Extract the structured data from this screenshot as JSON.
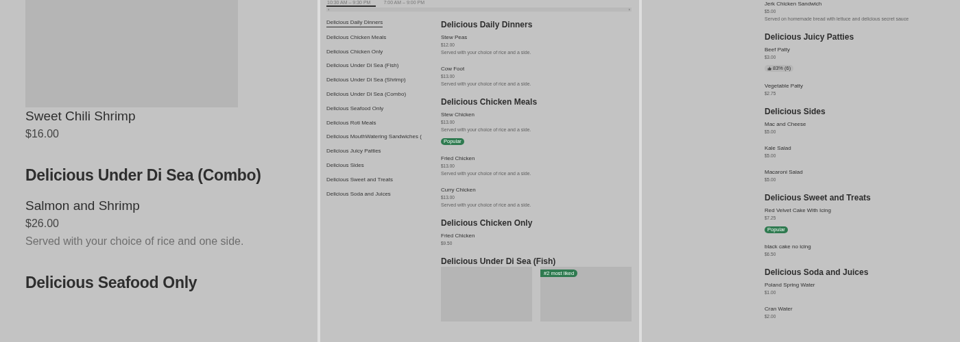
{
  "left_panel": {
    "sections": [
      {
        "items": [
          {
            "image": {
              "kind": "picture"
            },
            "name": "Sweet Chili Shrimp",
            "price": "$16.00"
          }
        ]
      },
      {
        "title": "Delicious Under Di Sea (Combo)",
        "items": [
          {
            "name": "Salmon and Shrimp",
            "price": "$26.00",
            "description": "Served with your choice of rice and one side."
          }
        ]
      },
      {
        "title": "Delicious Seafood Only"
      }
    ]
  },
  "middle_panel": {
    "hours_tabs": [
      {
        "label": "10:30 AM – 9:30 PM",
        "selected": true
      },
      {
        "label": "7:00 AM – 9:00 PM",
        "selected": false
      }
    ],
    "category_nav": [
      {
        "label": "Delicious Daily Dinners",
        "selected": true
      },
      {
        "label": "Delicious Chicken Meals",
        "selected": false
      },
      {
        "label": "Delicious Chicken Only",
        "selected": false
      },
      {
        "label": "Delicious Under Di Sea (Fish)",
        "selected": false
      },
      {
        "label": "Delicious Under Di Sea (Shrimp)",
        "selected": false
      },
      {
        "label": "Delicious Under Di Sea (Combo)",
        "selected": false
      },
      {
        "label": "Delicious Seafood Only",
        "selected": false
      },
      {
        "label": "Delicious Roti Meals",
        "selected": false
      },
      {
        "label": "Delicious MouthWatering Sandwiches (",
        "selected": false
      },
      {
        "label": "Delicious Juicy Patties",
        "selected": false
      },
      {
        "label": "Delicious Sides",
        "selected": false
      },
      {
        "label": "Delicious Sweet and Treats",
        "selected": false
      },
      {
        "label": "Delicious Soda and Juices",
        "selected": false
      }
    ],
    "sections": [
      {
        "title": "Delicious Daily Dinners",
        "items": [
          {
            "name": "Stew Peas",
            "price": "$12.00",
            "description": "Served with your choice of rice and a side."
          },
          {
            "name": "Cow Foot",
            "price": "$13.00",
            "description": "Served with your choice of rice and a side."
          }
        ]
      },
      {
        "title": "Delicious Chicken Meals",
        "items": [
          {
            "name": "Stew Chicken",
            "price": "$13.00",
            "description": "Served with your choice of rice and a side.",
            "tag": {
              "kind": "popular",
              "text": "Popular"
            }
          },
          {
            "name": "Fried Chicken",
            "price": "$13.00",
            "description": "Served with your choice of rice and a side."
          },
          {
            "name": "Curry Chicken",
            "price": "$13.00",
            "description": "Served with your choice of rice and a side."
          }
        ]
      },
      {
        "title": "Delicious Chicken Only",
        "items": [
          {
            "name": "Fried Chicken",
            "price": "$9.50"
          }
        ]
      },
      {
        "title": "Delicious Under Di Sea (Fish)",
        "cards": [
          {
            "kind": "picture"
          },
          {
            "kind": "picture",
            "badge": "#2 most liked"
          }
        ]
      }
    ]
  },
  "right_panel": {
    "sections": [
      {
        "items": [
          {
            "name": "Jerk Chicken Sandwich",
            "price": "$5.00",
            "description": "Served on homemade bread with lettuce and delicious secret sauce"
          }
        ]
      },
      {
        "title": "Delicious Juicy Patties",
        "items": [
          {
            "name": "Beef Patty",
            "price": "$3.00",
            "tag": {
              "kind": "rating",
              "text": "83% (6)"
            }
          },
          {
            "name": "Vegetable Patty",
            "price": "$2.75"
          }
        ]
      },
      {
        "title": "Delicious Sides",
        "items": [
          {
            "name": "Mac and Cheese",
            "price": "$5.00"
          },
          {
            "name": "Kale Salad",
            "price": "$5.00"
          },
          {
            "name": "Macaroni Salad",
            "price": "$5.00"
          }
        ]
      },
      {
        "title": "Delicious Sweet and Treats",
        "items": [
          {
            "name": "Red Velvet Cake With Icing",
            "price": "$7.25",
            "tag": {
              "kind": "popular",
              "text": "Popular"
            }
          },
          {
            "name": "black cake no icing",
            "price": "$6.50"
          }
        ]
      },
      {
        "title": "Delicious Soda and Juices",
        "items": [
          {
            "name": "Poland Spring Water",
            "price": "$1.00"
          },
          {
            "name": "Cran Water",
            "price": "$2.00"
          }
        ]
      }
    ]
  }
}
